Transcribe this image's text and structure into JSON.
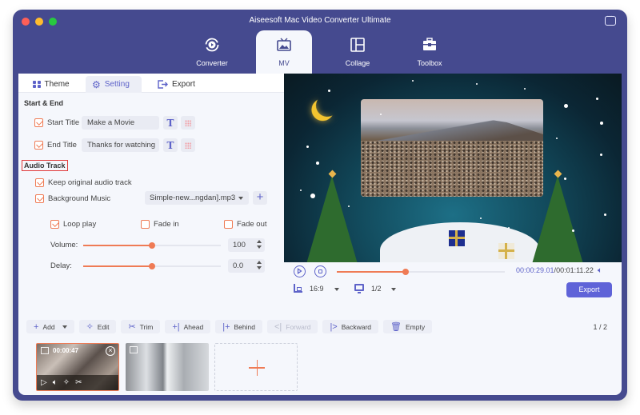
{
  "window": {
    "title": "Aiseesoft Mac Video Converter Ultimate",
    "feedback_icon": "chat-bubble-icon"
  },
  "nav": {
    "tabs": [
      {
        "label": "Converter",
        "icon": "converter-icon",
        "active": false
      },
      {
        "label": "MV",
        "icon": "mv-icon",
        "active": true
      },
      {
        "label": "Collage",
        "icon": "collage-icon",
        "active": false
      },
      {
        "label": "Toolbox",
        "icon": "toolbox-icon",
        "active": false
      }
    ]
  },
  "subtabs": [
    {
      "label": "Theme",
      "icon": "theme-grid-icon",
      "active": false
    },
    {
      "label": "Setting",
      "icon": "gear-icon",
      "active": true
    },
    {
      "label": "Export",
      "icon": "export-icon",
      "active": false
    }
  ],
  "settings": {
    "start_end_heading": "Start & End",
    "start_title": {
      "label": "Start Title",
      "checked": true,
      "value": "Make a Movie"
    },
    "end_title": {
      "label": "End Title",
      "checked": true,
      "value": "Thanks for watching"
    },
    "audio_heading": "Audio Track",
    "keep_original": {
      "label": "Keep original audio track",
      "checked": true
    },
    "background_music": {
      "label": "Background Music",
      "checked": true,
      "file": "Simple-new...ngdan].mp3"
    },
    "loop_play": {
      "label": "Loop play",
      "checked": true
    },
    "fade_in": {
      "label": "Fade in",
      "checked": false
    },
    "fade_out": {
      "label": "Fade out",
      "checked": false
    },
    "volume": {
      "label": "Volume:",
      "value": "100",
      "slider_fraction": 0.5
    },
    "delay": {
      "label": "Delay:",
      "value": "0.0",
      "slider_fraction": 0.5
    }
  },
  "player": {
    "current_time": "00:00:29.01",
    "separator": "/",
    "total_time": "00:01:11.22",
    "progress_fraction": 0.41,
    "aspect_ratio": "16:9",
    "screen_ratio": "1/2",
    "export_label": "Export"
  },
  "toolbar": {
    "add": "Add",
    "edit": "Edit",
    "trim": "Trim",
    "ahead": "Ahead",
    "behind": "Behind",
    "forward": "Forward",
    "backward": "Backward",
    "empty": "Empty"
  },
  "pager": "1 / 2",
  "clips": [
    {
      "duration": "00:00:47",
      "selected": true
    },
    {
      "duration": "",
      "selected": false
    }
  ]
}
